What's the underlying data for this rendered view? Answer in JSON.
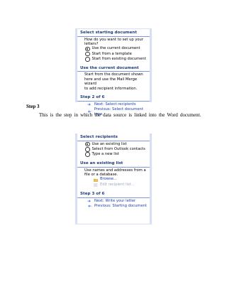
{
  "pane1": {
    "section1_title": "Select starting document",
    "question": [
      "How do you want to set up your",
      "letters?"
    ],
    "options": [
      {
        "label": "Use the current document",
        "selected": true
      },
      {
        "label": "Start from a template",
        "selected": false
      },
      {
        "label": "Start from existing document",
        "selected": false
      }
    ],
    "section2_title": "Use the current document",
    "description": [
      "Start from the document shown",
      "here and use the Mail Merge wizard",
      "to add recipient information."
    ],
    "step_title": "Step 2 of 6",
    "next_link": "Next: Select recipients",
    "prev_link": "Previous: Select document type"
  },
  "doc": {
    "step_heading": "Step 3",
    "paragraph": "This is the step in which the data source is linked into the Word document."
  },
  "pane2": {
    "section1_title": "Select recipients",
    "options": [
      {
        "label": "Use an existing list",
        "selected": true
      },
      {
        "label": "Select from Outlook contacts",
        "selected": false
      },
      {
        "label": "Type a new list",
        "selected": false
      }
    ],
    "section2_title": "Use an existing list",
    "description": [
      "Use names and addresses from a",
      "file or a database."
    ],
    "browse_label": "Browse...",
    "edit_label": "Edit recipient list...",
    "step_title": "Step 3 of 6",
    "next_link": "Next: Write your letter",
    "prev_link": "Previous: Starting document"
  },
  "colors": {
    "accent": "#1a3ea8",
    "pane_border": "#d6dff7",
    "heading": "#1f3d7a"
  }
}
